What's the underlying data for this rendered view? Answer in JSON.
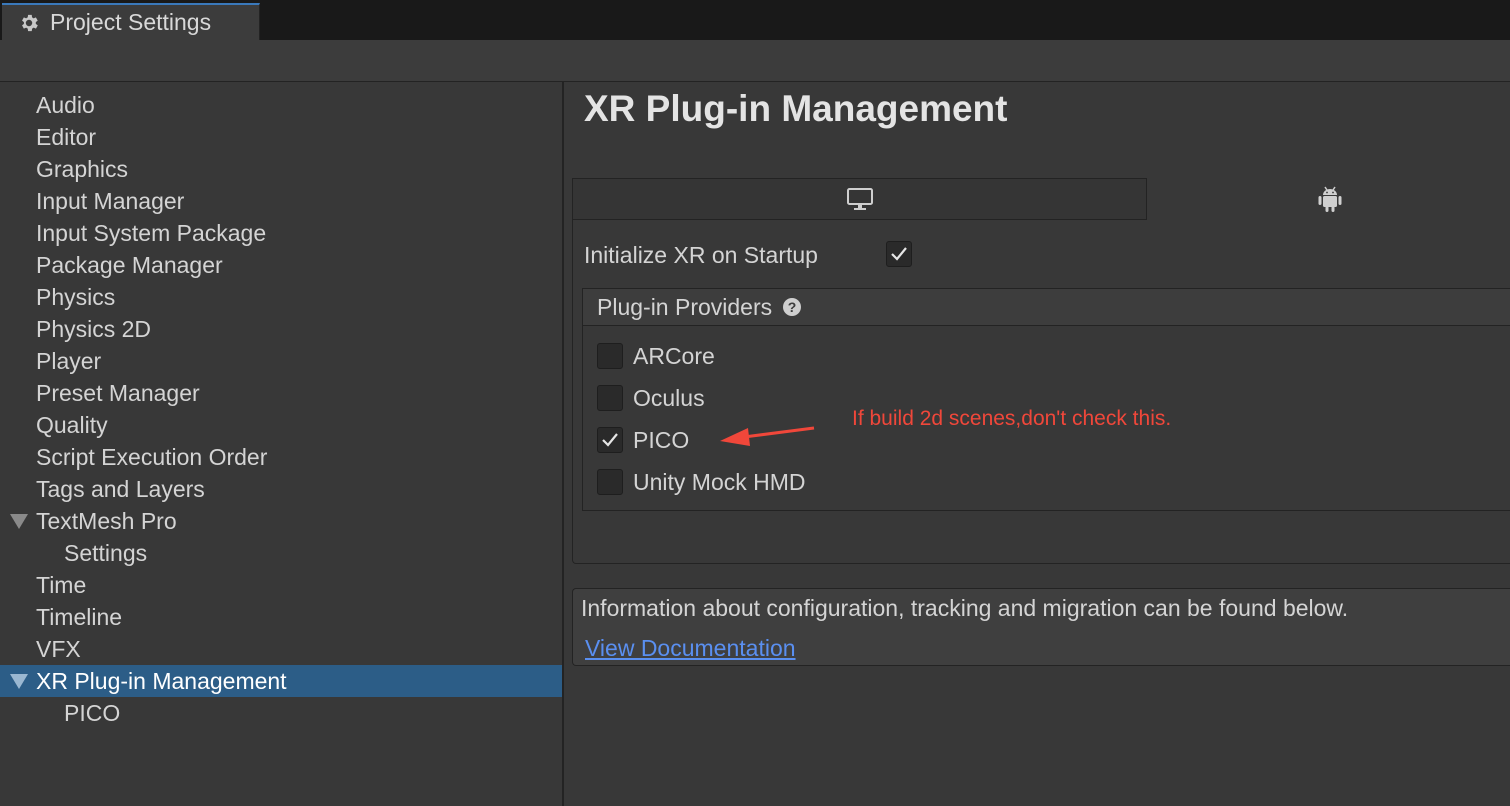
{
  "window": {
    "tab_title": "Project Settings",
    "tab_icon": "gear-icon"
  },
  "sidebar": {
    "items": [
      {
        "label": "Audio"
      },
      {
        "label": "Editor"
      },
      {
        "label": "Graphics"
      },
      {
        "label": "Input Manager"
      },
      {
        "label": "Input System Package"
      },
      {
        "label": "Package Manager"
      },
      {
        "label": "Physics"
      },
      {
        "label": "Physics 2D"
      },
      {
        "label": "Player"
      },
      {
        "label": "Preset Manager"
      },
      {
        "label": "Quality"
      },
      {
        "label": "Script Execution Order"
      },
      {
        "label": "Tags and Layers"
      },
      {
        "label": "TextMesh Pro",
        "expanded": true
      },
      {
        "label": "Settings",
        "child": true
      },
      {
        "label": "Time"
      },
      {
        "label": "Timeline"
      },
      {
        "label": "VFX"
      },
      {
        "label": "XR Plug-in Management",
        "expanded": true,
        "selected": true
      },
      {
        "label": "PICO",
        "child": true
      }
    ]
  },
  "main": {
    "title": "XR Plug-in Management",
    "platform_tabs": [
      {
        "icon": "monitor-icon",
        "selected": false
      },
      {
        "icon": "android-icon",
        "selected": true
      }
    ],
    "init_on_startup": {
      "label": "Initialize XR on Startup",
      "checked": true
    },
    "providers": {
      "header": "Plug-in Providers",
      "items": [
        {
          "label": "ARCore",
          "checked": false
        },
        {
          "label": "Oculus",
          "checked": false
        },
        {
          "label": "PICO",
          "checked": true
        },
        {
          "label": "Unity Mock HMD",
          "checked": false
        }
      ]
    },
    "annotation": "If build 2d scenes,don't check this.",
    "info": {
      "text": "Information about configuration, tracking and migration can be found below.",
      "link": "View Documentation"
    }
  },
  "colors": {
    "selection": "#2c5d87",
    "link": "#5a8ff0",
    "annotation": "#f0473a",
    "tab_accent": "#3a79bb"
  }
}
